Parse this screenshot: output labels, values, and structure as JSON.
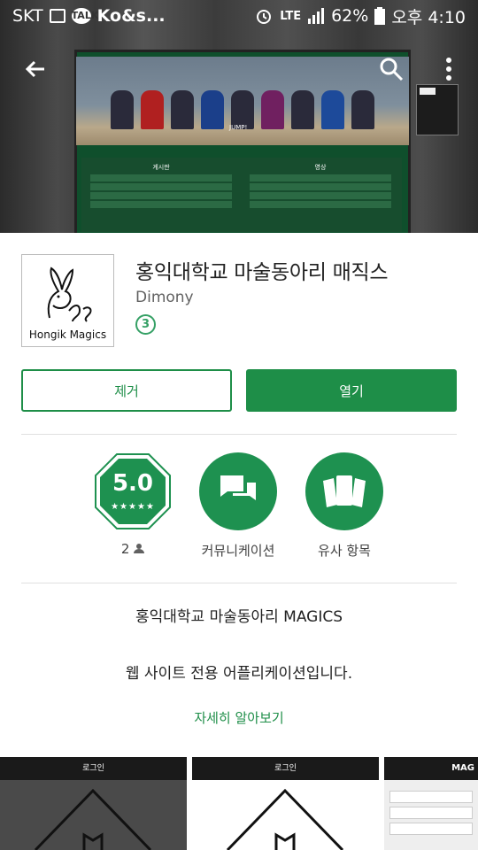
{
  "status_bar": {
    "carrier": "SKT",
    "notification_text": "Ko&s...",
    "signal_label": "LTE",
    "battery": "62%",
    "time": "오후 4:10"
  },
  "hero": {
    "photo_caption": "JUMP!",
    "board_left_heading": "게시판",
    "board_right_heading": "영상"
  },
  "app": {
    "title": "홍익대학교 마술동아리 매직스",
    "developer": "Dimony",
    "content_rating": "3",
    "icon_caption": "Hongik Magics"
  },
  "actions": {
    "remove_label": "제거",
    "open_label": "열기"
  },
  "stats": {
    "rating_value": "5.0",
    "rating_stars": "★★★★★",
    "review_count": "2",
    "category_label": "커뮤니케이션",
    "similar_label": "유사 항목"
  },
  "description": {
    "line1": "홍익대학교 마술동아리 MAGICS",
    "line2": "웹 사이트 전용 어플리케이션입니다.",
    "more_label": "자세히 알아보기"
  },
  "screenshots": {
    "shot1_header": "로그인",
    "shot2_header": "로그인",
    "shot3_header": "MAG"
  },
  "colors": {
    "accent": "#1e8e48",
    "rating_badge": "#35a065"
  }
}
